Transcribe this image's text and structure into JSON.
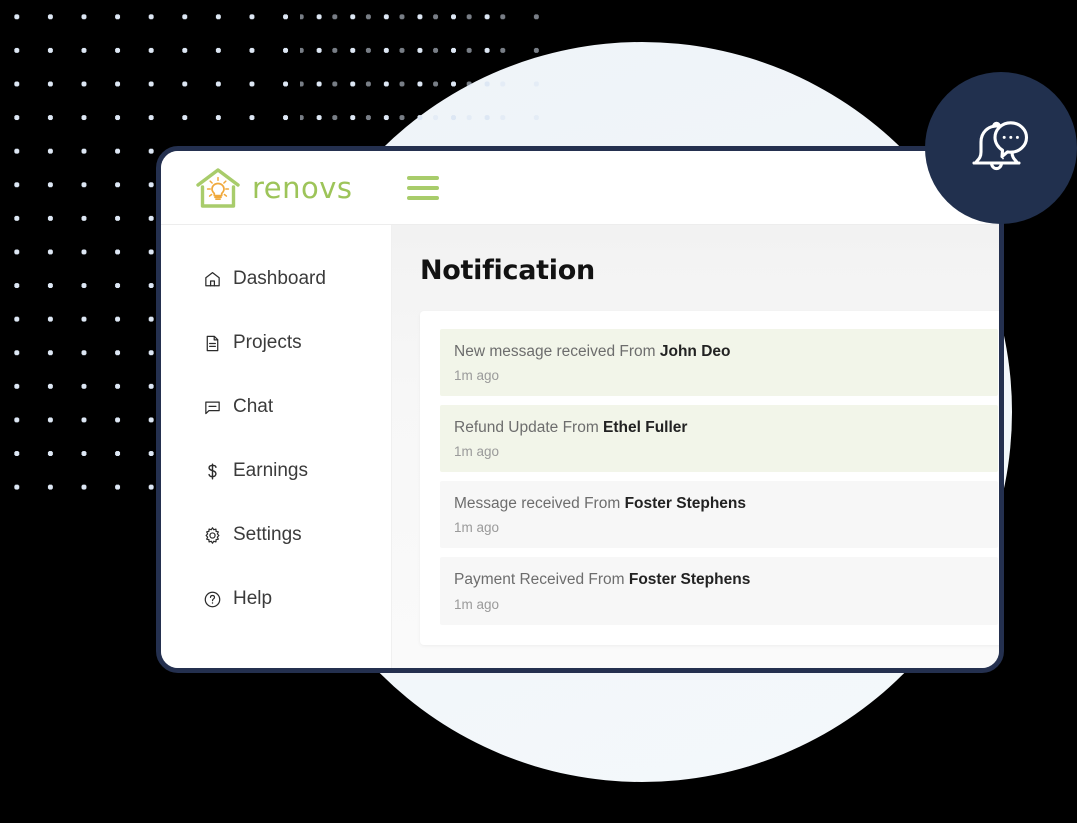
{
  "brand": {
    "name": "renovs",
    "logo_icon": "house-lightbulb-icon",
    "accent_green": "#a8cc6b",
    "logo_bulb_color": "#f0a93c"
  },
  "header": {
    "menu_icon": "hamburger-menu-icon"
  },
  "sidebar": {
    "items": [
      {
        "label": "Dashboard",
        "icon": "home-icon"
      },
      {
        "label": "Projects",
        "icon": "document-icon"
      },
      {
        "label": "Chat",
        "icon": "chat-bubble-icon"
      },
      {
        "label": "Earnings",
        "icon": "dollar-icon"
      },
      {
        "label": "Settings",
        "icon": "gear-icon"
      },
      {
        "label": "Help",
        "icon": "question-circle-icon"
      }
    ]
  },
  "main": {
    "title": "Notification",
    "notifications": [
      {
        "message": "New message received From ",
        "sender": "John Deo",
        "time": "1m ago",
        "tint": "green"
      },
      {
        "message": "Refund Update From ",
        "sender": "Ethel Fuller",
        "time": "1m ago",
        "tint": "green"
      },
      {
        "message": "Message received From ",
        "sender": "Foster Stephens",
        "time": "1m ago",
        "tint": "grey"
      },
      {
        "message": "Payment Received From ",
        "sender": "Foster Stephens",
        "time": "1m ago",
        "tint": "grey"
      }
    ]
  },
  "badge": {
    "icon": "bell-chat-notification-icon",
    "circle_color": "#21304e"
  },
  "decor": {
    "dot_color": "#dde7f4",
    "circle_color": "#f1f6fa",
    "window_border_color": "#24304f"
  }
}
